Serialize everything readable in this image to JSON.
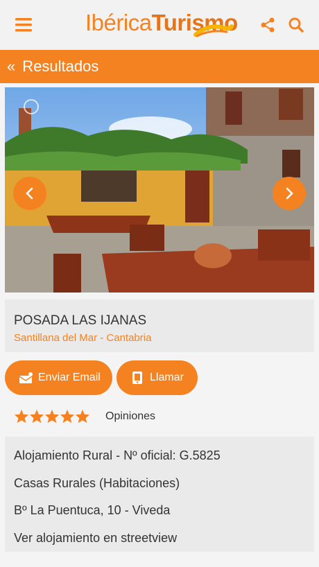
{
  "app": {
    "logo_part1": "Ibérica",
    "logo_part2": "Turismo"
  },
  "header": {
    "menu_icon": "hamburger-icon",
    "share_icon": "share-icon",
    "search_icon": "search-icon"
  },
  "nav_bar": {
    "back_icon": "double-chevron-left-icon",
    "title": "Resultados"
  },
  "gallery": {
    "prev_icon": "chevron-left-icon",
    "next_icon": "chevron-right-icon"
  },
  "listing": {
    "name": "POSADA LAS IJANAS",
    "location": "Santillana del Mar - Cantabria"
  },
  "actions": {
    "email_label": "Enviar Email",
    "email_icon": "email-icon",
    "call_label": "Llamar",
    "call_icon": "phone-icon"
  },
  "rating": {
    "stars": 5,
    "max": 5,
    "label": "Opiniones"
  },
  "details": {
    "category": "Alojamiento Rural - Nº oficial: G.5825",
    "type": "Casas Rurales (Habitaciones)",
    "address": "Bº La Puentuca, 10 - Viveda",
    "streetview_link": "Ver alojamiento en streetview"
  },
  "colors": {
    "accent": "#f58220",
    "card_bg": "#eaeaea"
  }
}
